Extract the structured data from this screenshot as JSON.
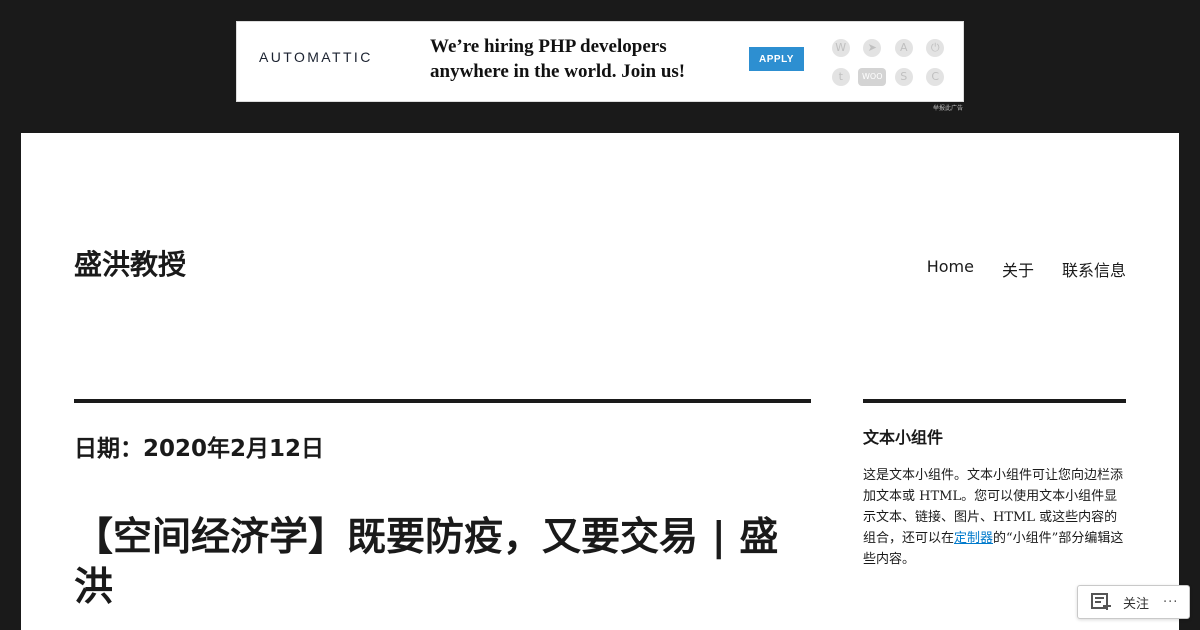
{
  "ad": {
    "logo": "AUTOMATTIC",
    "headline_line1": "We’re hiring PHP developers",
    "headline_line2": "anywhere in the world. Join us!",
    "apply_label": "APPLY",
    "report_label": "举报此广告",
    "brand_icons": [
      "wordpress-icon",
      "jetpack-icon",
      "akismet-icon",
      "power-icon",
      "tumblr-icon",
      "woo-icon",
      "simplenote-icon",
      "cloudup-icon"
    ],
    "brand_icon_glyphs": [
      "W",
      "➤",
      "A",
      "⏻",
      "t",
      "WOO",
      "S",
      "C"
    ]
  },
  "header": {
    "site_title": "盛洪教授",
    "nav": [
      "Home",
      "关于",
      "联系信息"
    ]
  },
  "main": {
    "archive_title": "日期：2020年2月12日",
    "post_title": "【空间经济学】既要防疫，又要交易 | 盛洪"
  },
  "sidebar": {
    "widget_title": "文本小组件",
    "text_before_link": "这是文本小组件。文本小组件可让您向边栏添加文本或 HTML。您可以使用文本小组件显示文本、链接、图片、HTML 或这些内容的组合，还可以在",
    "link_text": "定制器",
    "text_after_link": "的“小组件”部分编辑这些内容。"
  },
  "follow": {
    "label": "关注",
    "more": "···"
  },
  "colors": {
    "background": "#1a1a1a",
    "page": "#ffffff",
    "text": "#1a1a1a",
    "link": "#007acc",
    "apply_button": "#2d8fd1"
  }
}
